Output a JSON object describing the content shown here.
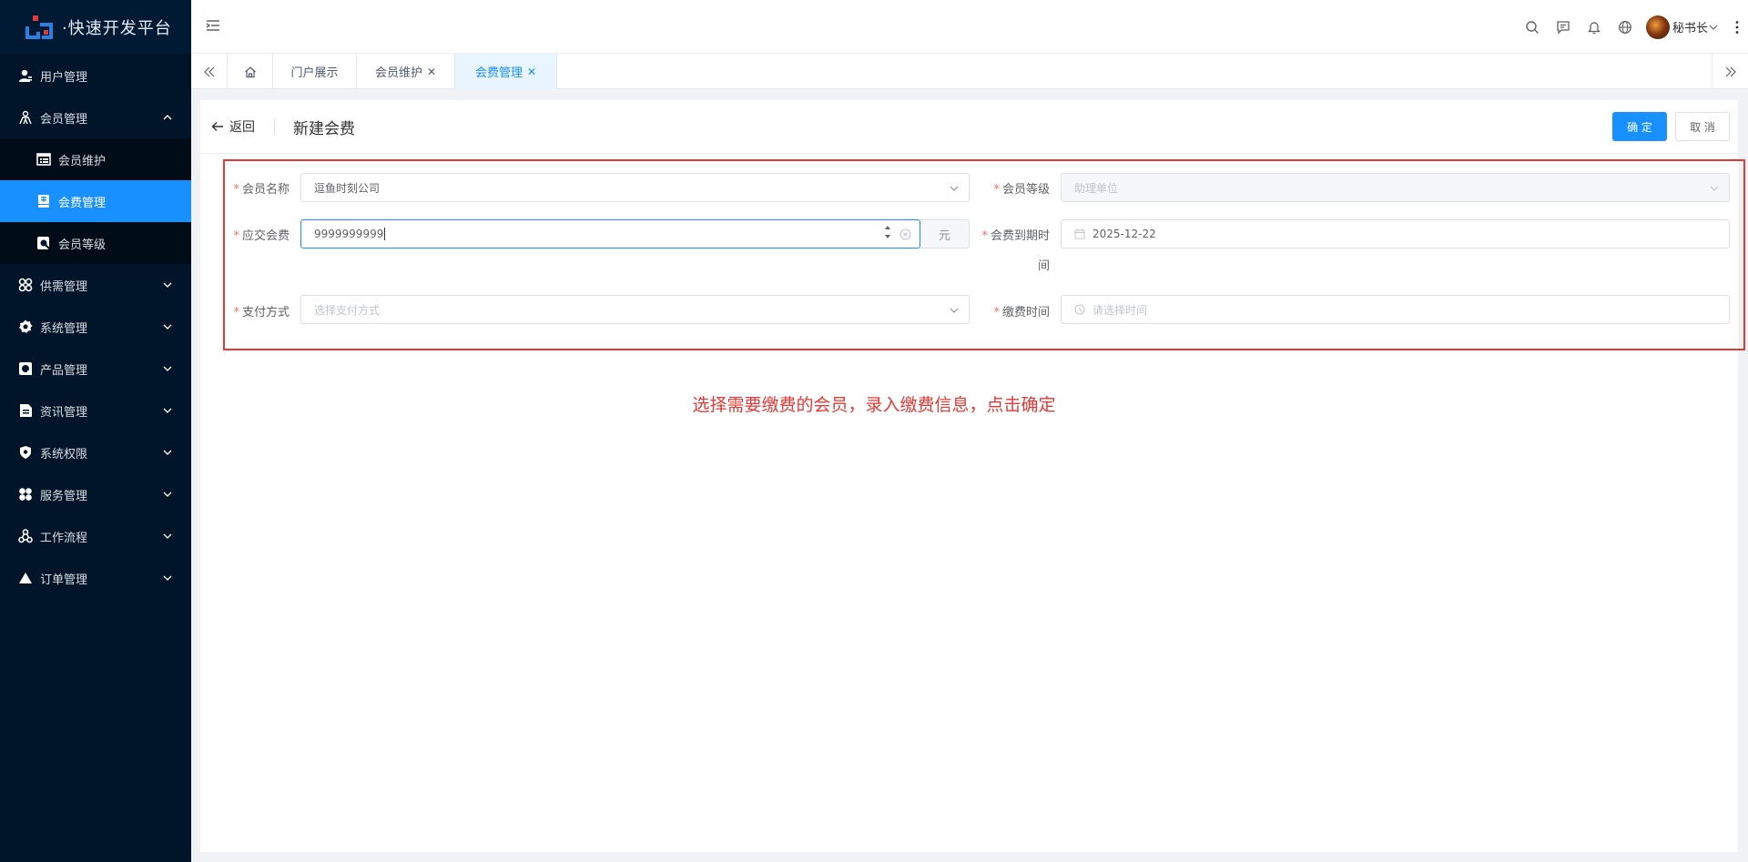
{
  "app": {
    "logo_text": "·快速开发平台"
  },
  "sidebar": {
    "items": [
      {
        "label": "用户管理",
        "icon": "user-icon"
      },
      {
        "label": "会员管理",
        "icon": "members-icon",
        "expanded": true
      },
      {
        "label": "会员维护",
        "icon": "table-icon"
      },
      {
        "label": "会费管理",
        "icon": "fee-icon",
        "active": true
      },
      {
        "label": "会员等级",
        "icon": "level-icon"
      },
      {
        "label": "供需管理",
        "icon": "grid-icon"
      },
      {
        "label": "系统管理",
        "icon": "gear-icon"
      },
      {
        "label": "产品管理",
        "icon": "product-icon"
      },
      {
        "label": "资讯管理",
        "icon": "document-icon"
      },
      {
        "label": "系统权限",
        "icon": "shield-icon"
      },
      {
        "label": "服务管理",
        "icon": "service-icon"
      },
      {
        "label": "工作流程",
        "icon": "workflow-icon"
      },
      {
        "label": "订单管理",
        "icon": "triangle-icon"
      }
    ]
  },
  "header": {
    "user_name": "秘书长"
  },
  "tabs": [
    {
      "label": "门户展示"
    },
    {
      "label": "会员维护",
      "closable": true
    },
    {
      "label": "会费管理",
      "closable": true,
      "active": true
    }
  ],
  "page": {
    "back_label": "返回",
    "title": "新建会费",
    "confirm_label": "确 定",
    "cancel_label": "取 消"
  },
  "form": {
    "member_name": {
      "label": "会员名称",
      "value": "逗鱼时刻公司"
    },
    "member_level": {
      "label": "会员等级",
      "value": "助理单位"
    },
    "fee_due": {
      "label": "应交会费",
      "value": "9999999999",
      "unit": "元"
    },
    "expiry": {
      "label_line1": "会费到期时",
      "label_line2": "间",
      "value": "2025-12-22"
    },
    "payment_method": {
      "label": "支付方式",
      "placeholder": "选择支付方式"
    },
    "payment_time": {
      "label": "缴费时间",
      "placeholder": "请选择时间"
    }
  },
  "annotation": {
    "text": "选择需要缴费的会员，录入缴费信息，点击确定"
  },
  "colors": {
    "primary": "#1890ff",
    "sidebar": "#001529",
    "annotation_red": "#e53935"
  }
}
